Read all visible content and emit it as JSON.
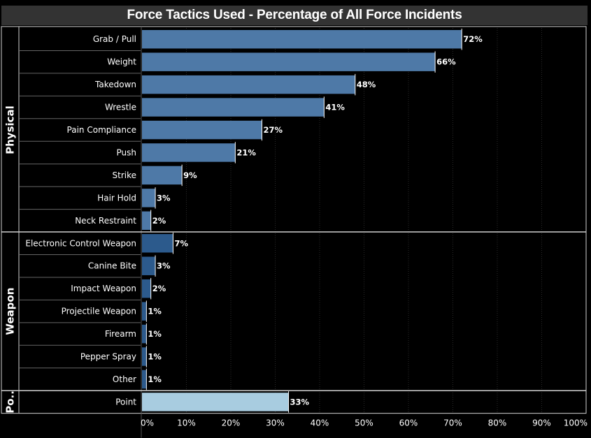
{
  "chart_data": {
    "type": "bar",
    "orientation": "horizontal",
    "title": "Force Tactics Used - Percentage of All Force Incidents",
    "xlabel": "",
    "ylabel": "",
    "xlim": [
      0,
      100
    ],
    "x_ticks": [
      "0%",
      "10%",
      "20%",
      "30%",
      "40%",
      "50%",
      "60%",
      "70%",
      "80%",
      "90%",
      "100%"
    ],
    "grid": "vertical dotted",
    "groups": [
      {
        "name": "Physical",
        "color": "#4e79a7",
        "categories": [
          "Grab / Pull",
          "Weight",
          "Takedown",
          "Wrestle",
          "Pain Compliance",
          "Push",
          "Strike",
          "Hair Hold",
          "Neck Restraint"
        ],
        "values": [
          72,
          66,
          48,
          41,
          27,
          21,
          9,
          3,
          2
        ],
        "labels": [
          "72%",
          "66%",
          "48%",
          "41%",
          "27%",
          "21%",
          "9%",
          "3%",
          "2%"
        ]
      },
      {
        "name": "Weapon",
        "color": "#2c5a8c",
        "categories": [
          "Electronic Control Weapon",
          "Canine Bite",
          "Impact Weapon",
          "Projectile Weapon",
          "Firearm",
          "Pepper Spray",
          "Other"
        ],
        "values": [
          7,
          3,
          2,
          1,
          1,
          1,
          1
        ],
        "labels": [
          "7%",
          "3%",
          "2%",
          "1%",
          "1%",
          "1%",
          "1%"
        ]
      },
      {
        "name": "Po..",
        "color": "#a8cce0",
        "categories": [
          "Point"
        ],
        "values": [
          33
        ],
        "labels": [
          "33%"
        ]
      }
    ]
  }
}
